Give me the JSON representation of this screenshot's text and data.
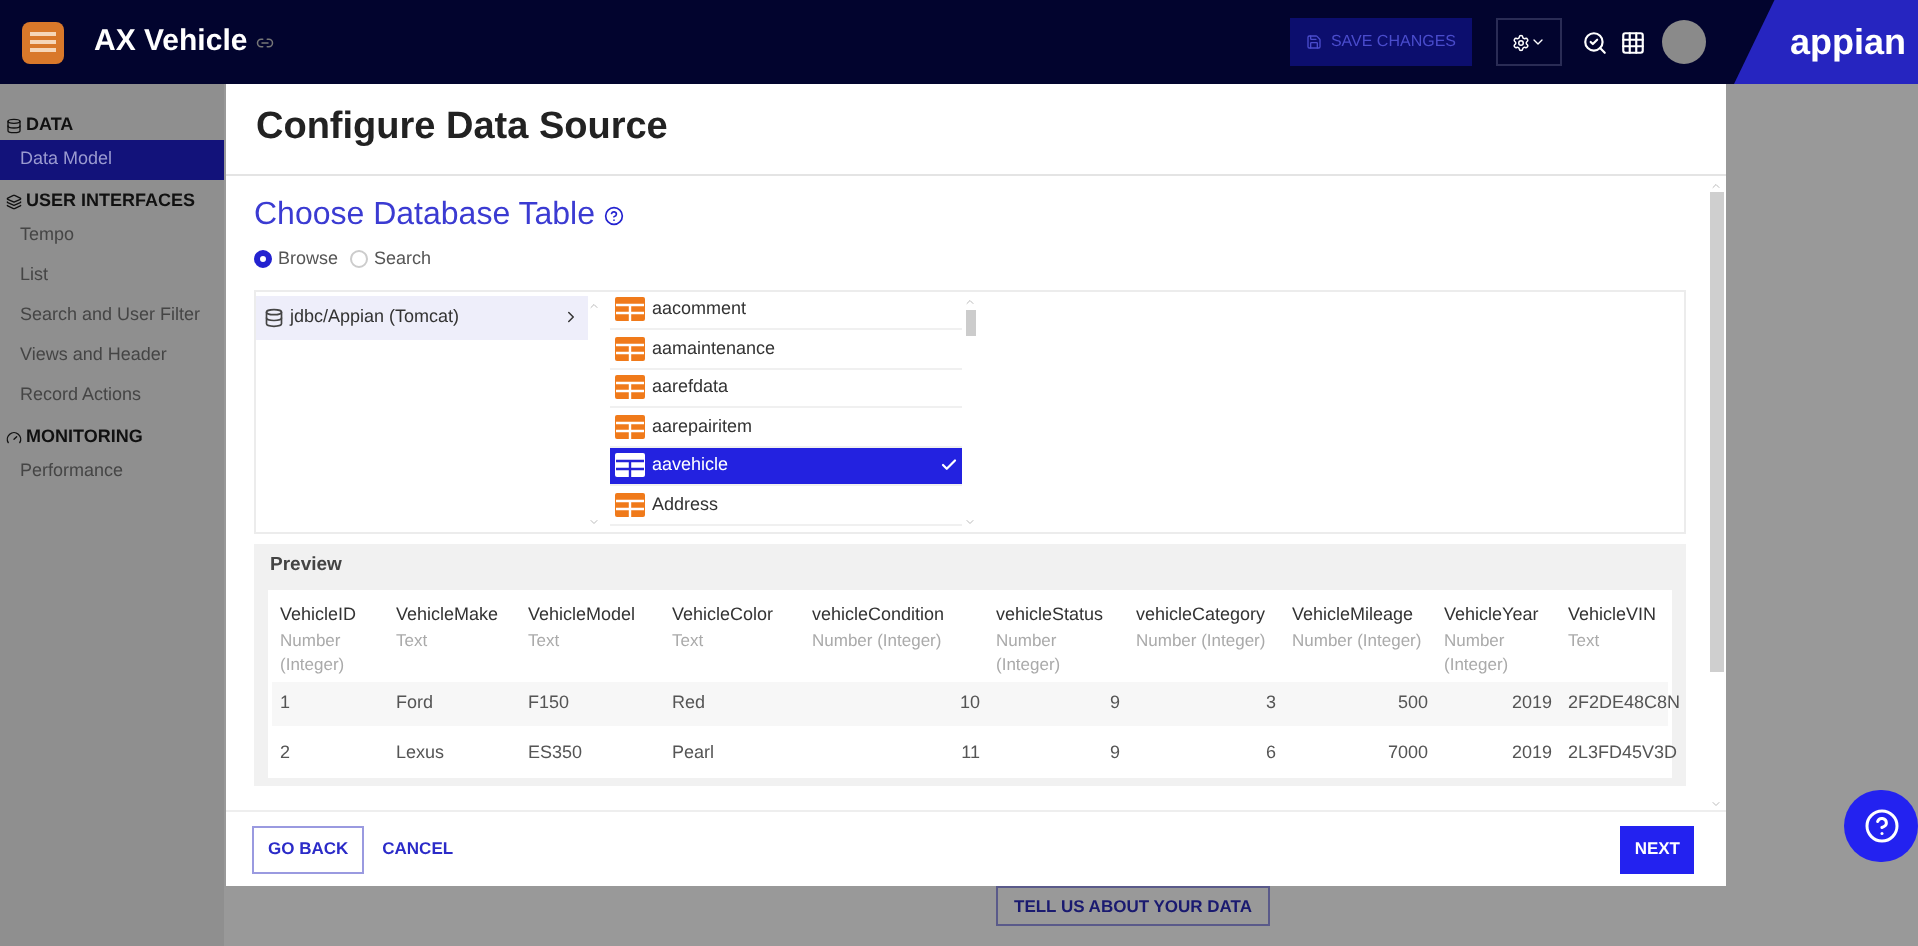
{
  "top_bar": {
    "app_title": "AX Vehicle",
    "save_button": "SAVE CHANGES",
    "brand": "appian"
  },
  "sidebar": {
    "sections": [
      {
        "title": "DATA",
        "kind": "data",
        "items": [
          {
            "label": "Data Model",
            "selected": true
          }
        ]
      },
      {
        "title": "USER INTERFACES",
        "kind": "interfaces",
        "items": [
          {
            "label": "Tempo",
            "selected": false
          },
          {
            "label": "List",
            "selected": false
          },
          {
            "label": "Search and User Filter",
            "selected": false
          },
          {
            "label": "Views and Header",
            "selected": false
          },
          {
            "label": "Record Actions",
            "selected": false
          }
        ]
      },
      {
        "title": "MONITORING",
        "kind": "monitoring",
        "items": [
          {
            "label": "Performance",
            "selected": false
          }
        ]
      }
    ]
  },
  "modal": {
    "title": "Configure Data Source",
    "subtitle": "Choose Database Table",
    "modes": [
      {
        "label": "Browse",
        "selected": true
      },
      {
        "label": "Search",
        "selected": false
      }
    ],
    "sources": [
      {
        "label": "jdbc/Appian (Tomcat)",
        "selected": true
      }
    ],
    "tables": [
      {
        "label": "aacomment",
        "selected": false
      },
      {
        "label": "aamaintenance",
        "selected": false
      },
      {
        "label": "aarefdata",
        "selected": false
      },
      {
        "label": "aarepairitem",
        "selected": false
      },
      {
        "label": "aavehicle",
        "selected": true
      },
      {
        "label": "Address",
        "selected": false
      }
    ],
    "preview": {
      "title": "Preview",
      "columns": [
        {
          "name": "VehicleID",
          "type": "Number (Integer)",
          "kind": "plain"
        },
        {
          "name": "VehicleMake",
          "type": "Text",
          "kind": "plain"
        },
        {
          "name": "VehicleModel",
          "type": "Text",
          "kind": "plain"
        },
        {
          "name": "VehicleColor",
          "type": "Text",
          "kind": "plain"
        },
        {
          "name": "vehicleCondition",
          "type": "Number (Integer)",
          "kind": "numeric"
        },
        {
          "name": "vehicleStatus",
          "type": "Number (Integer)",
          "kind": "numeric"
        },
        {
          "name": "vehicleCategory",
          "type": "Number (Integer)",
          "kind": "numeric"
        },
        {
          "name": "VehicleMileage",
          "type": "Number (Integer)",
          "kind": "numeric"
        },
        {
          "name": "VehicleYear",
          "type": "Number (Integer)",
          "kind": "numeric"
        },
        {
          "name": "VehicleVIN",
          "type": "Text",
          "kind": "plain"
        }
      ],
      "rows": [
        [
          "1",
          "Ford",
          "F150",
          "Red",
          "10",
          "9",
          "3",
          "500",
          "2019",
          "2F2DE48C8N"
        ],
        [
          "2",
          "Lexus",
          "ES350",
          "Pearl",
          "11",
          "9",
          "6",
          "7000",
          "2019",
          "2L3FD45V3D"
        ]
      ]
    },
    "back_button": "GO BACK",
    "cancel_button": "CANCEL",
    "next_button": "NEXT"
  },
  "page": {
    "tell_button": "TELL US ABOUT YOUR DATA"
  }
}
